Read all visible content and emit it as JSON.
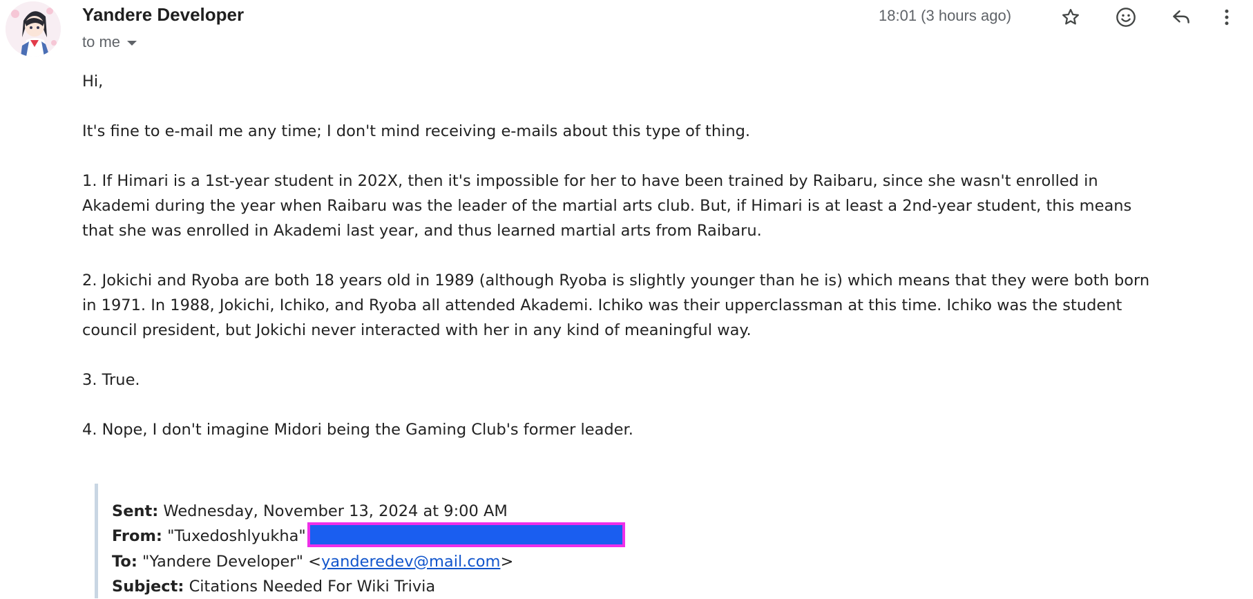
{
  "header": {
    "sender_name": "Yandere Developer",
    "recipient_label": "to me",
    "timestamp": "18:01 (3 hours ago)",
    "actions": [
      "star-icon",
      "emoji-icon",
      "reply-icon",
      "more-vert-icon"
    ]
  },
  "body": {
    "greeting": "Hi,",
    "intro": "It's fine to e-mail me any time; I don't mind receiving e-mails about this type of thing.",
    "line1a": "1. If Himari is a 1st-year student in 202X, then it's impossible for her to have been trained by Raibaru, since she wasn't enrolled in",
    "line1b": "Akademi during the year when Raibaru was the leader of the martial arts club. But, if Himari is at least a 2nd-year student, this means",
    "line1c": "that she was enrolled in Akademi last year, and thus learned martial arts from Raibaru.",
    "line2a": "2. Jokichi and Ryoba are both 18 years old in 1989 (although Ryoba is slightly younger than he is) which means that they were both born",
    "line2b": "in 1971. In 1988, Jokichi, Ichiko, and Ryoba all attended Akademi. Ichiko was their upperclassman at this time. Ichiko was the student",
    "line2c": "council president, but Jokichi never interacted with her in any kind of meaningful way.",
    "line3": "3. True.",
    "line4": "4. Nope, I don't imagine Midori being the Gaming Club's former leader."
  },
  "quoted": {
    "sent_label": "Sent:",
    "sent_value": "Wednesday, November 13, 2024 at 9:00 AM",
    "from_label": "From:",
    "from_value": "\"Tuxedoshlyukha\"",
    "to_label": "To:",
    "to_name": "\"Yandere Developer\" <",
    "to_email": "yanderedev@mail.com",
    "to_close": ">",
    "subject_label": "Subject:",
    "subject_value": "Citations Needed For Wiki Trivia"
  },
  "colors": {
    "link": "#1155cc",
    "redaction_fill": "#1a5ef0",
    "redaction_border": "#ee2fe9",
    "quote_bar": "#c9d6e3"
  }
}
